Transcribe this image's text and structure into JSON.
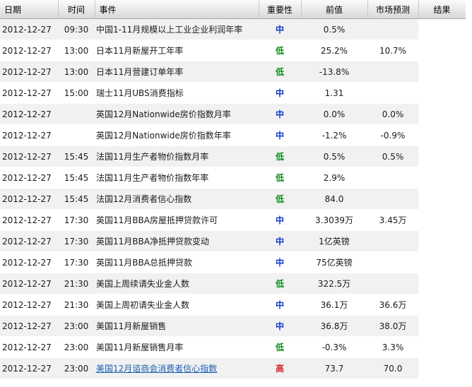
{
  "columns": {
    "date": "日期",
    "time": "时间",
    "event": "事件",
    "importance": "重要性",
    "previous": "前值",
    "forecast": "市场预测",
    "result": "结果"
  },
  "importance_colors": {
    "中": "#0b36c9",
    "低": "#0b8a18",
    "高": "#d8232a"
  },
  "rows": [
    {
      "date": "2012-12-27",
      "time": "09:30",
      "event": "中国1-11月规模以上工业企业利润年率",
      "importance": "中",
      "previous": "0.5%",
      "forecast": "",
      "result": ""
    },
    {
      "date": "2012-12-27",
      "time": "13:00",
      "event": "日本11月新屋开工年率",
      "importance": "低",
      "previous": "25.2%",
      "forecast": "10.7%",
      "result": ""
    },
    {
      "date": "2012-12-27",
      "time": "13:00",
      "event": "日本11月营建订单年率",
      "importance": "低",
      "previous": "-13.8%",
      "forecast": "",
      "result": ""
    },
    {
      "date": "2012-12-27",
      "time": "15:00",
      "event": "瑞士11月UBS消费指标",
      "importance": "中",
      "previous": "1.31",
      "forecast": "",
      "result": ""
    },
    {
      "date": "2012-12-27",
      "time": "",
      "event": "英国12月Nationwide房价指数月率",
      "importance": "中",
      "previous": "0.0%",
      "forecast": "0.0%",
      "result": ""
    },
    {
      "date": "2012-12-27",
      "time": "",
      "event": "英国12月Nationwide房价指数年率",
      "importance": "中",
      "previous": "-1.2%",
      "forecast": "-0.9%",
      "result": ""
    },
    {
      "date": "2012-12-27",
      "time": "15:45",
      "event": "法国11月生产者物价指数月率",
      "importance": "低",
      "previous": "0.5%",
      "forecast": "0.5%",
      "result": ""
    },
    {
      "date": "2012-12-27",
      "time": "15:45",
      "event": "法国11月生产者物价指数年率",
      "importance": "低",
      "previous": "2.9%",
      "forecast": "",
      "result": ""
    },
    {
      "date": "2012-12-27",
      "time": "15:45",
      "event": "法国12月消费者信心指数",
      "importance": "低",
      "previous": "84.0",
      "forecast": "",
      "result": ""
    },
    {
      "date": "2012-12-27",
      "time": "17:30",
      "event": "英国11月BBA房屋抵押贷款许可",
      "importance": "中",
      "previous": "3.3039万",
      "forecast": "3.45万",
      "result": ""
    },
    {
      "date": "2012-12-27",
      "time": "17:30",
      "event": "英国11月BBA净抵押贷款变动",
      "importance": "中",
      "previous": "1亿英镑",
      "forecast": "",
      "result": ""
    },
    {
      "date": "2012-12-27",
      "time": "17:30",
      "event": "英国11月BBA总抵押贷款",
      "importance": "中",
      "previous": "75亿英镑",
      "forecast": "",
      "result": ""
    },
    {
      "date": "2012-12-27",
      "time": "21:30",
      "event": "美国上周续请失业金人数",
      "importance": "低",
      "previous": "322.5万",
      "forecast": "",
      "result": ""
    },
    {
      "date": "2012-12-27",
      "time": "21:30",
      "event": "美国上周初请失业金人数",
      "importance": "中",
      "previous": "36.1万",
      "forecast": "36.6万",
      "result": ""
    },
    {
      "date": "2012-12-27",
      "time": "23:00",
      "event": "美国11月新屋销售",
      "importance": "中",
      "previous": "36.8万",
      "forecast": "38.0万",
      "result": ""
    },
    {
      "date": "2012-12-27",
      "time": "23:00",
      "event": "美国11月新屋销售月率",
      "importance": "低",
      "previous": "-0.3%",
      "forecast": "3.3%",
      "result": ""
    },
    {
      "date": "2012-12-27",
      "time": "23:00",
      "event": "美国12月谘商会消费者信心指数",
      "importance": "高",
      "previous": "73.7",
      "forecast": "70.0",
      "result": "",
      "link": true
    }
  ]
}
